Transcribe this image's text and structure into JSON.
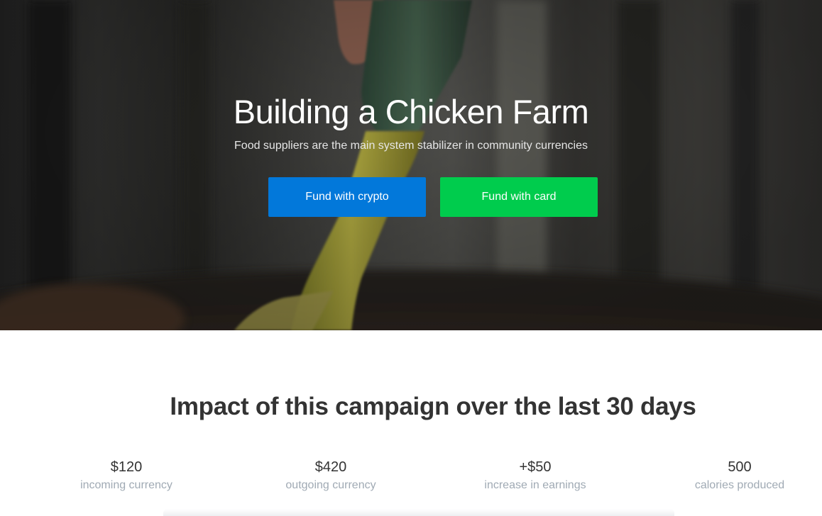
{
  "hero": {
    "title": "Building a Chicken Farm",
    "subtitle": "Food suppliers are the main system stabilizer in community currencies",
    "buttons": {
      "crypto_label": "Fund with crypto",
      "card_label": "Fund with card"
    },
    "colors": {
      "crypto": "#0278da",
      "card": "#00cc4d"
    }
  },
  "impact": {
    "title": "Impact of this campaign over the last 30 days",
    "stats": [
      {
        "value": "$120",
        "label": "incoming currency"
      },
      {
        "value": "$420",
        "label": "outgoing currency"
      },
      {
        "value": "+$50",
        "label": "increase in earnings"
      },
      {
        "value": "500",
        "label": "calories produced"
      }
    ]
  }
}
